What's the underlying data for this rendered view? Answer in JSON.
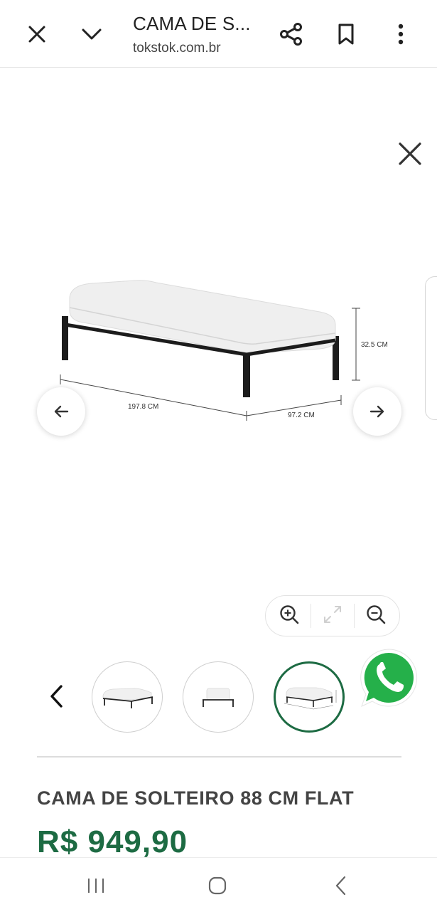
{
  "browser": {
    "title": "CAMA DE S...",
    "url": "tokstok.com.br",
    "icons": [
      "close-icon",
      "chevron-down-icon",
      "share-icon",
      "bookmark-icon",
      "more-vert-icon"
    ]
  },
  "viewer": {
    "dimensions": {
      "length": "197.8 CM",
      "width": "97.2 CM",
      "height": "32.5 CM"
    },
    "icons": [
      "close-icon",
      "arrow-left-icon",
      "arrow-right-icon",
      "zoom-in-icon",
      "expand-icon",
      "zoom-out-icon"
    ]
  },
  "thumbnails": {
    "count": 3,
    "active_index": 2
  },
  "product": {
    "name": "CAMA DE SOLTEIRO 88 CM FLAT",
    "price": "R$ 949,90"
  },
  "colors": {
    "accent_green": "#1d6b43",
    "whatsapp_green": "#25b04a"
  }
}
